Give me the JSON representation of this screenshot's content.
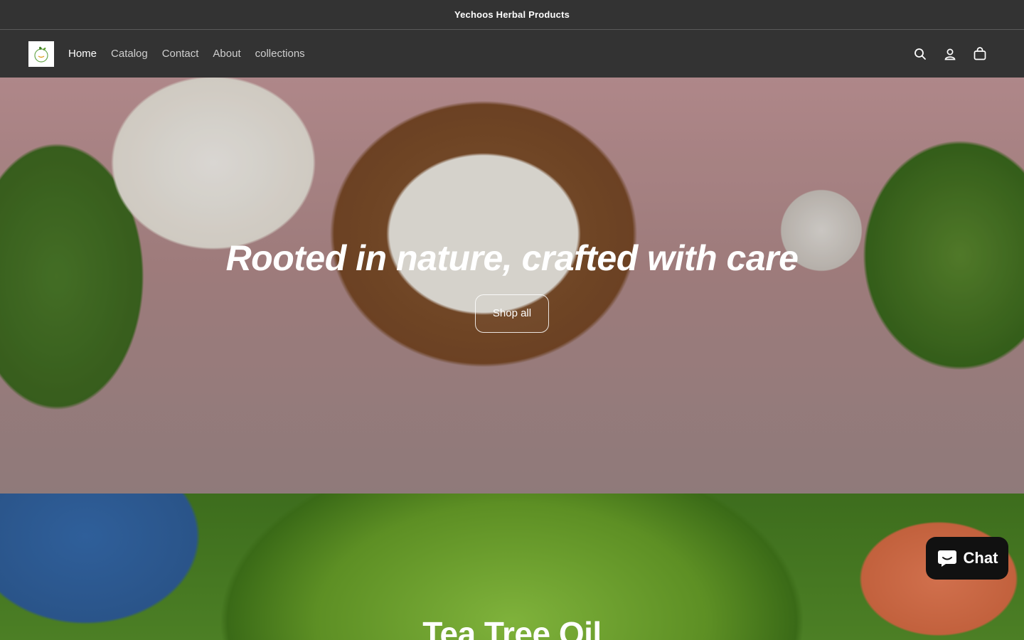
{
  "announcement": {
    "text": "Yechoos Herbal Products"
  },
  "header": {
    "logo_alt": "Yechoos",
    "nav": [
      {
        "label": "Home",
        "active": true
      },
      {
        "label": "Catalog",
        "active": false
      },
      {
        "label": "Contact",
        "active": false
      },
      {
        "label": "About",
        "active": false
      },
      {
        "label": "collections",
        "active": false
      }
    ],
    "icons": [
      "search-icon",
      "account-icon",
      "cart-icon"
    ]
  },
  "hero": {
    "title": "Rooted in nature, crafted with care",
    "button_label": "Shop all"
  },
  "section2": {
    "title": "Tea Tree Oil"
  },
  "chat": {
    "label": "Chat"
  },
  "colors": {
    "header_bg": "#333333",
    "text": "#ffffff",
    "nav_inactive": "#cfcfcf",
    "chat_bg": "#111111"
  }
}
